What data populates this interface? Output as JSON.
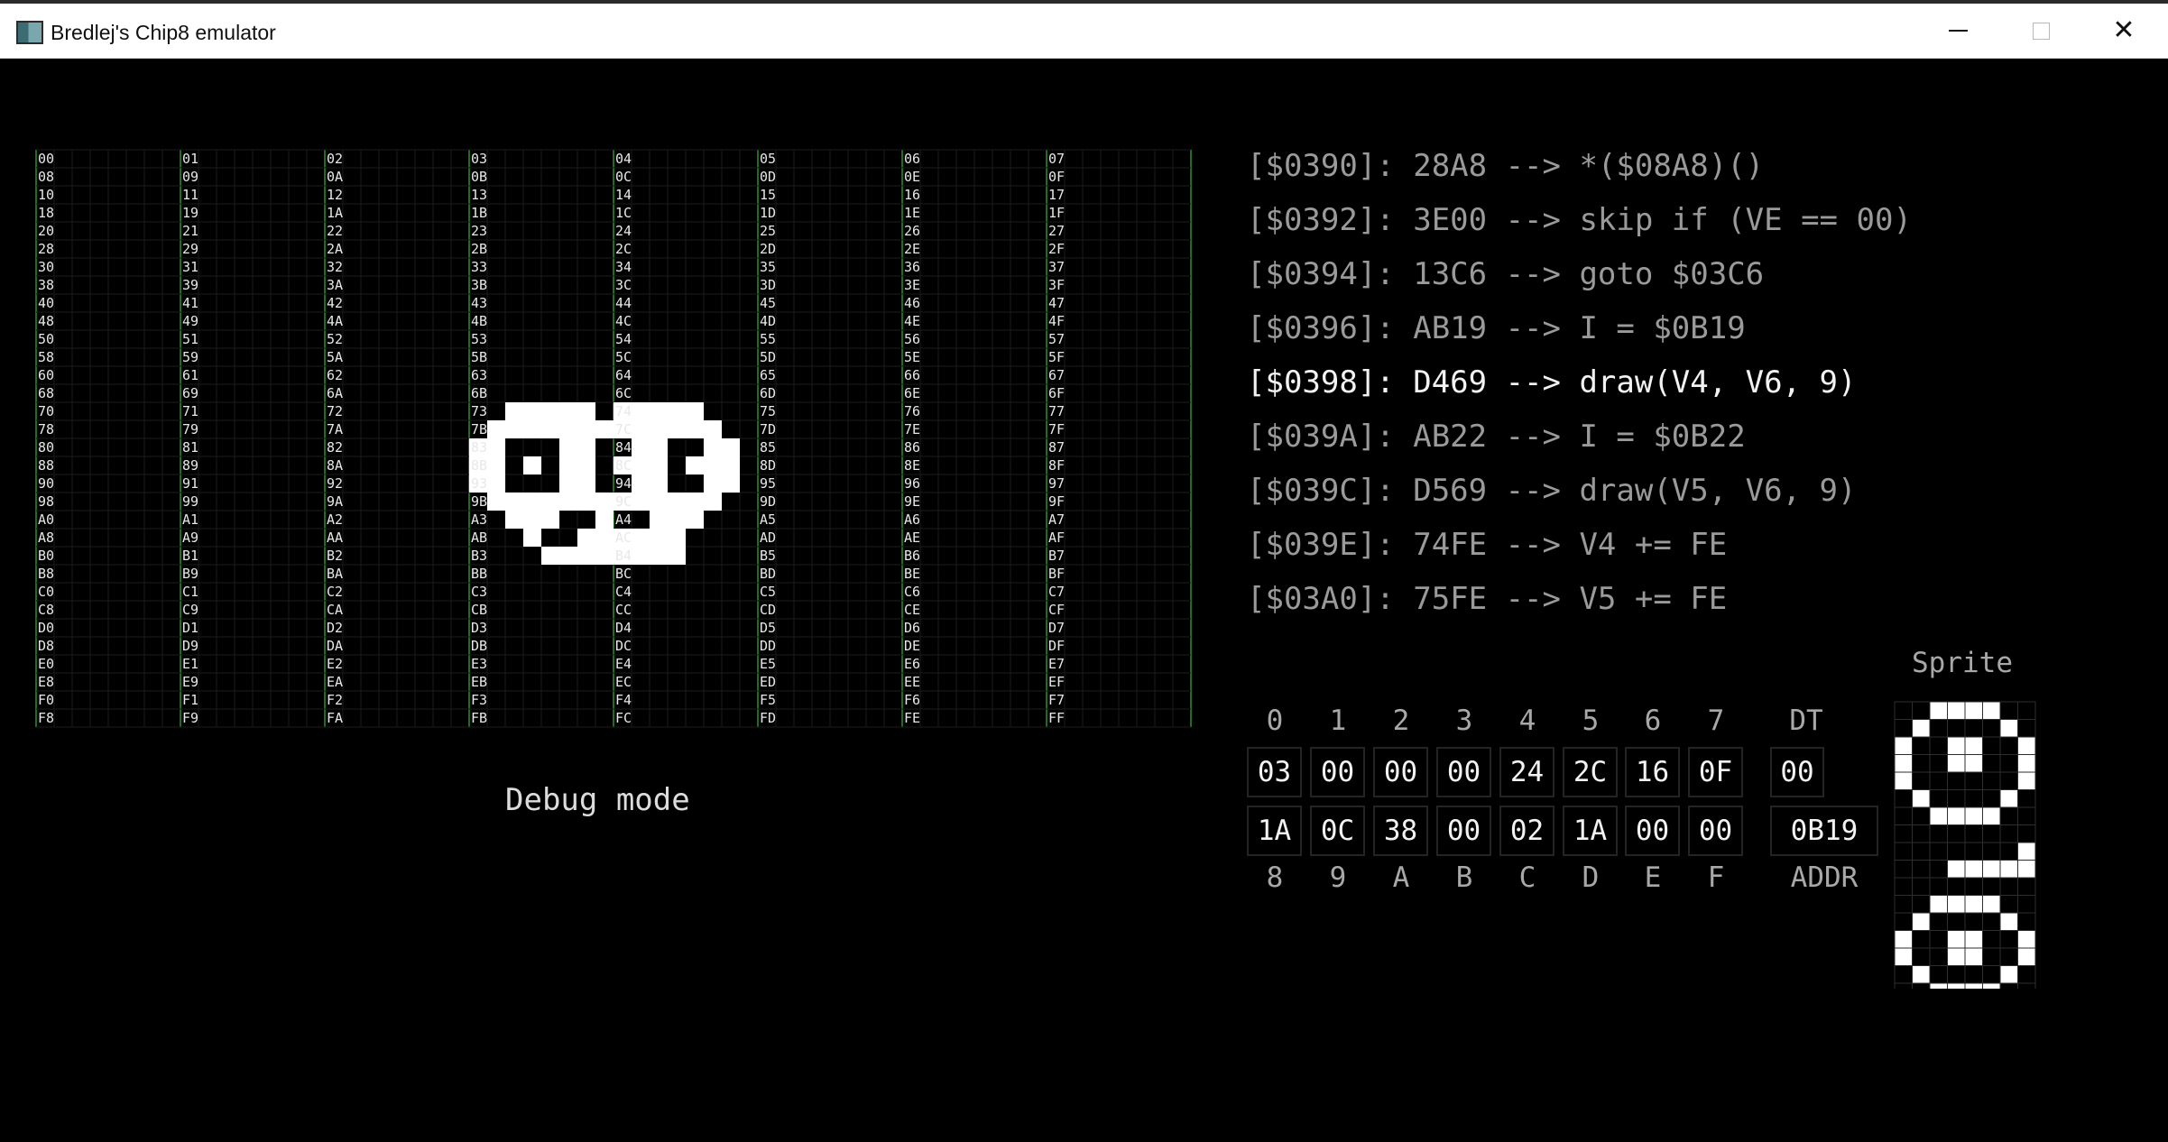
{
  "window": {
    "title": "Bredlej's Chip8 emulator",
    "minimize_icon": "minimize-icon",
    "maximize_icon": "maximize-icon",
    "close_icon": "close-icon"
  },
  "screen_pixels": [
    "001111101111100",
    "011111111111110",
    "110001100110011",
    "110101101110111",
    "110001100110011",
    "011111111111110",
    "001110010011100",
    "000100111111000",
    "000011111111000"
  ],
  "memory_view": {
    "columns": [
      [
        "00",
        "08",
        "10",
        "18",
        "20",
        "28",
        "30",
        "38",
        "40",
        "48",
        "50",
        "58",
        "60",
        "68",
        "70",
        "78",
        "80",
        "88",
        "90",
        "98",
        "A0",
        "A8",
        "B0",
        "B8",
        "C0",
        "C8",
        "D0",
        "D8",
        "E0",
        "E8",
        "F0",
        "F8"
      ],
      [
        "01",
        "09",
        "11",
        "19",
        "21",
        "29",
        "31",
        "39",
        "41",
        "49",
        "51",
        "59",
        "61",
        "69",
        "71",
        "79",
        "81",
        "89",
        "91",
        "99",
        "A1",
        "A9",
        "B1",
        "B9",
        "C1",
        "C9",
        "D1",
        "D9",
        "E1",
        "E9",
        "F1",
        "F9"
      ],
      [
        "02",
        "0A",
        "12",
        "1A",
        "22",
        "2A",
        "32",
        "3A",
        "42",
        "4A",
        "52",
        "5A",
        "62",
        "6A",
        "72",
        "7A",
        "82",
        "8A",
        "92",
        "9A",
        "A2",
        "AA",
        "B2",
        "BA",
        "C2",
        "CA",
        "D2",
        "DA",
        "E2",
        "EA",
        "F2",
        "FA"
      ],
      [
        "03",
        "0B",
        "13",
        "1B",
        "23",
        "2B",
        "33",
        "3B",
        "43",
        "4B",
        "53",
        "5B",
        "63",
        "6B",
        "73",
        "7B",
        "83",
        "8B",
        "93",
        "9B",
        "A3",
        "AB",
        "B3",
        "BB",
        "C3",
        "CB",
        "D3",
        "DB",
        "E3",
        "EB",
        "F3",
        "FB"
      ],
      [
        "04",
        "0C",
        "14",
        "1C",
        "24",
        "2C",
        "34",
        "3C",
        "44",
        "4C",
        "54",
        "5C",
        "64",
        "6C",
        "74",
        "7C",
        "84",
        "8C",
        "94",
        "9C",
        "A4",
        "AC",
        "B4",
        "BC",
        "C4",
        "CC",
        "D4",
        "DC",
        "E4",
        "EC",
        "F4",
        "FC"
      ],
      [
        "05",
        "0D",
        "15",
        "1D",
        "25",
        "2D",
        "35",
        "3D",
        "45",
        "4D",
        "55",
        "5D",
        "65",
        "6D",
        "75",
        "7D",
        "85",
        "8D",
        "95",
        "9D",
        "A5",
        "AD",
        "B5",
        "BD",
        "C5",
        "CD",
        "D5",
        "DD",
        "E5",
        "ED",
        "F5",
        "FD"
      ],
      [
        "06",
        "0E",
        "16",
        "1E",
        "26",
        "2E",
        "36",
        "3E",
        "46",
        "4E",
        "56",
        "5E",
        "66",
        "6E",
        "76",
        "7E",
        "86",
        "8E",
        "96",
        "9E",
        "A6",
        "AE",
        "B6",
        "BE",
        "C6",
        "CE",
        "D6",
        "DE",
        "E6",
        "EE",
        "F6",
        "FE"
      ],
      [
        "07",
        "0F",
        "17",
        "1F",
        "27",
        "2F",
        "37",
        "3F",
        "47",
        "4F",
        "57",
        "5F",
        "67",
        "6F",
        "77",
        "7F",
        "87",
        "8F",
        "97",
        "9F",
        "A7",
        "AF",
        "B7",
        "BF",
        "C7",
        "CF",
        "D7",
        "DF",
        "E7",
        "EF",
        "F7",
        "FF"
      ]
    ]
  },
  "debug_label": "Debug mode",
  "disassembly": [
    {
      "text": "[$0390]: 28A8 --> *($08A8)()",
      "current": false
    },
    {
      "text": "[$0392]: 3E00 --> skip if (VE == 00)",
      "current": false
    },
    {
      "text": "[$0394]: 13C6 --> goto $03C6",
      "current": false
    },
    {
      "text": "[$0396]: AB19 --> I = $0B19",
      "current": false
    },
    {
      "text": "[$0398]: D469 --> draw(V4, V6, 9)",
      "current": true
    },
    {
      "text": "[$039A]: AB22 --> I = $0B22",
      "current": false
    },
    {
      "text": "[$039C]: D569 --> draw(V5, V6, 9)",
      "current": false
    },
    {
      "text": "[$039E]: 74FE --> V4 += FE",
      "current": false
    },
    {
      "text": "[$03A0]: 75FE --> V5 += FE",
      "current": false
    }
  ],
  "registers": {
    "top_labels": [
      "0",
      "1",
      "2",
      "3",
      "4",
      "5",
      "6",
      "7"
    ],
    "top_values": [
      "03",
      "00",
      "00",
      "00",
      "24",
      "2C",
      "16",
      "0F"
    ],
    "bottom_values": [
      "1A",
      "0C",
      "38",
      "00",
      "02",
      "1A",
      "00",
      "00"
    ],
    "bottom_labels": [
      "8",
      "9",
      "A",
      "B",
      "C",
      "D",
      "E",
      "F"
    ],
    "dt_label": "DT",
    "dt_value": "00",
    "addr_value": "0B19",
    "addr_label": "ADDR"
  },
  "sprite": {
    "label": "Sprite",
    "rows": [
      "00111100",
      "01000010",
      "10011001",
      "10011001",
      "10000001",
      "01000010",
      "00111100",
      "00000000",
      "00000001",
      "00011111",
      "00000000",
      "00111100",
      "01000010",
      "10011001",
      "10011001",
      "01000010",
      "00111100"
    ]
  },
  "colors": {
    "grid_border": "#1d6e1d",
    "grid_line": "#1b1b1b",
    "pixel_on": "#ffffff",
    "instruction_current": "#f2f2f2",
    "instruction_other": "#9a9a9a"
  }
}
